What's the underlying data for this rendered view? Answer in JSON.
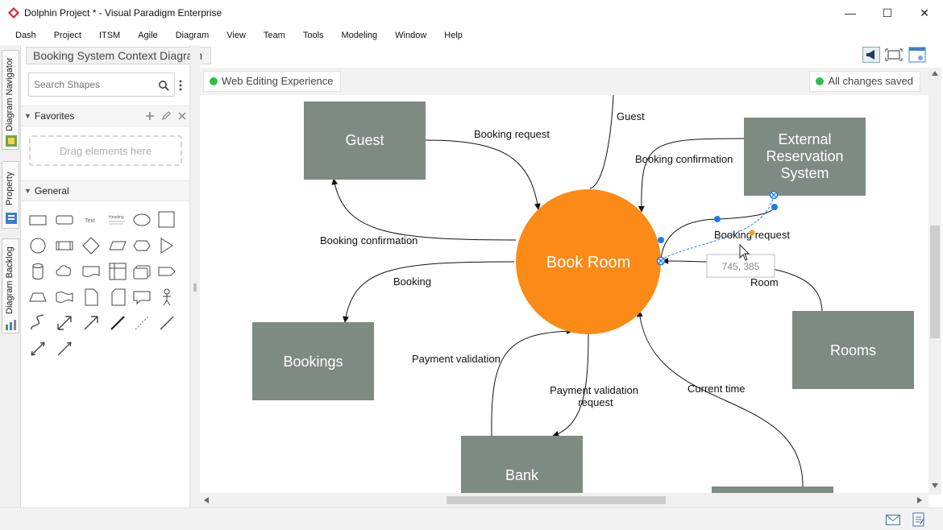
{
  "window": {
    "title": "Dolphin Project * - Visual Paradigm Enterprise",
    "minimize": "—",
    "maximize": "☐",
    "close": "✕"
  },
  "menu": [
    "Dash",
    "Project",
    "ITSM",
    "Agile",
    "Diagram",
    "View",
    "Team",
    "Tools",
    "Modeling",
    "Window",
    "Help"
  ],
  "breadcrumb": "Booking System Context Diagram",
  "left_tabs": {
    "navigator": "Diagram Navigator",
    "property": "Property",
    "backlog": "Diagram Backlog"
  },
  "palette": {
    "search_placeholder": "Search Shapes",
    "favorites_label": "Favorites",
    "drop_hint": "Drag elements here",
    "general_label": "General",
    "text_tool": "Text",
    "heading_tool": "Heading"
  },
  "canvas": {
    "left_badge": "Web Editing Experience",
    "right_badge": "All changes saved",
    "coord_tooltip": "745, 385"
  },
  "diagram": {
    "process": "Book Room",
    "entities": {
      "guest": "Guest",
      "external_line1": "External",
      "external_line2": "Reservation",
      "external_line3": "System",
      "bookings": "Bookings",
      "rooms": "Rooms",
      "bank": "Bank"
    },
    "flows": {
      "guest_top": "Guest",
      "booking_request": "Booking request",
      "booking_confirmation_ext": "Booking confirmation",
      "booking_confirmation_guest": "Booking confirmation",
      "booking_request_ext": "Booking request",
      "booking": "Booking",
      "room": "Room",
      "payment_validation": "Payment validation",
      "payment_validation_request_1": "Payment validation",
      "payment_validation_request_2": "request",
      "current_time": "Current time"
    }
  },
  "colors": {
    "entity_fill": "#7e8b83",
    "process_fill": "#fb8a17",
    "selection_blue": "#1f7ae6",
    "status_green": "#2bbf4e"
  }
}
